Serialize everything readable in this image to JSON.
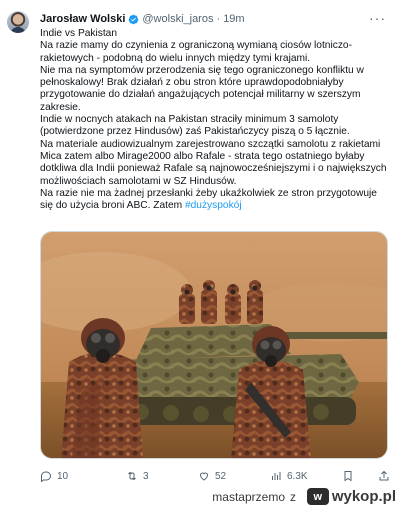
{
  "tweet": {
    "author": {
      "name": "Jarosław Wolski",
      "handle": "@wolski_jaros",
      "time": "· 19m"
    },
    "more_label": "···",
    "paragraphs": [
      "Indie vs Pakistan",
      "Na razie mamy do czynienia z ograniczoną wymianą ciosów lotniczo-rakietowych - podobną do wielu innych między tymi krajami.",
      "Nie ma na symptomów przerodzenia się tego ograniczonego konfliktu w pełnoskalowy! Brak działań z obu stron które uprawdopodobniałyby przygotowanie do działań angażujących potencjał militarny w szerszym zakresie.",
      "Indie w nocnych atakach na Pakistan straciły minimum 3 samoloty (potwierdzone przez Hindusów) zaś Pakistańczycy piszą o 5 łącznie.",
      "Na materiale audiowizualnym zarejestrowano szczątki samolotu z rakietami Mica zatem albo Mirage2000 albo Rafale - strata tego ostatniego byłaby dotkliwa dla Indii ponieważ Rafale są najnowocześniejszymi i o największych możliwościach samolotami w SZ Hindusów."
    ],
    "last_paragraph": "Na razie nie ma żadnej przesłanki  żeby ukaźkolwiek ze stron przygotowuje się do użycia broni ABC. Zatem ",
    "hashtag": "#dużyspokój",
    "stats": {
      "replies": "10",
      "reposts": "3",
      "likes": "52",
      "views": "6.3K"
    }
  },
  "footer": {
    "username": "mastaprzemo",
    "connector": "z",
    "site": "wykop.pl",
    "logo_mark": "w"
  },
  "colors": {
    "accent": "#1d9bf0",
    "muted": "#536471",
    "text": "#0f1419"
  }
}
